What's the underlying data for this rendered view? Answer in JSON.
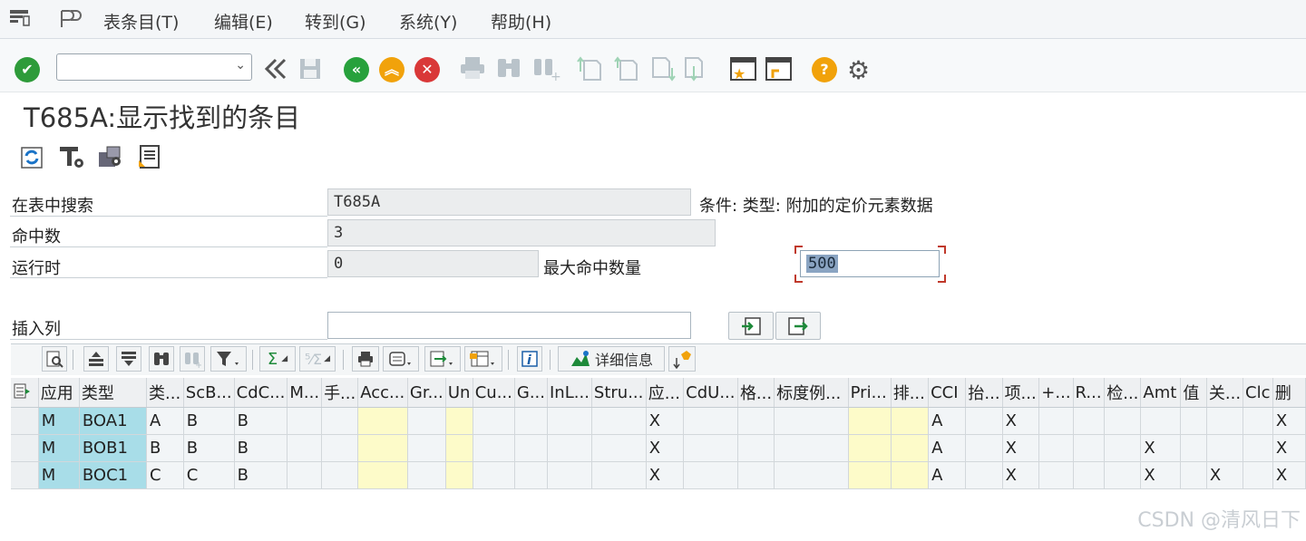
{
  "menubar": {
    "items": [
      "表条目(T)",
      "编辑(E)",
      "转到(G)",
      "系统(Y)",
      "帮助(H)"
    ]
  },
  "toolbar": {
    "icons": [
      "enter-icon",
      "command-field",
      "collapse-icon",
      "save-icon",
      "back-icon",
      "exit-icon",
      "cancel-icon",
      "print-icon",
      "find-icon",
      "find-next-icon",
      "first-page-icon",
      "prev-page-icon",
      "next-page-icon",
      "last-page-icon",
      "create-session-icon",
      "shortcut-icon",
      "help-icon",
      "settings-icon"
    ],
    "command_value": ""
  },
  "page": {
    "title": "T685A:显示找到的条目"
  },
  "form": {
    "search_table_label": "在表中搜索",
    "search_table_value": "T685A",
    "condition_text": "条件: 类型: 附加的定价元素数据",
    "hits_label": "命中数",
    "hits_value": "3",
    "runtime_label": "运行时",
    "runtime_value": "0",
    "max_hits_label": "最大命中数量",
    "max_hits_value": "500",
    "insert_col_label": "插入列",
    "insert_col_value": ""
  },
  "gridtoolbar": {
    "details_label": "详细信息"
  },
  "table": {
    "headers": [
      "应用",
      "类型",
      "类...",
      "ScB...",
      "CdC...",
      "M...",
      "手...",
      "Acc...",
      "Gr...",
      "Un",
      "Cu...",
      "G...",
      "InL...",
      "Stru...",
      "应...",
      "CdU...",
      "格...",
      "标度例...",
      "Pri...",
      "排...",
      "CCI",
      "抬...",
      "项...",
      "+...",
      "R...",
      "检...",
      "Amt",
      "值",
      "关...",
      "Clc",
      "删"
    ],
    "rows": [
      [
        "M",
        "BOA1",
        "A",
        "B",
        "B",
        "",
        "",
        "",
        "",
        "",
        "",
        "",
        "",
        "",
        "X",
        "",
        "",
        "",
        "",
        "",
        "A",
        "",
        "X",
        "",
        "",
        "",
        "",
        "",
        "",
        "",
        "X"
      ],
      [
        "M",
        "BOB1",
        "B",
        "B",
        "B",
        "",
        "",
        "",
        "",
        "",
        "",
        "",
        "",
        "",
        "X",
        "",
        "",
        "",
        "",
        "",
        "A",
        "",
        "X",
        "",
        "",
        "",
        "X",
        "",
        "",
        "",
        "X"
      ],
      [
        "M",
        "BOC1",
        "C",
        "C",
        "B",
        "",
        "",
        "",
        "",
        "",
        "",
        "",
        "",
        "",
        "X",
        "",
        "",
        "",
        "",
        "",
        "A",
        "",
        "X",
        "",
        "",
        "",
        "X",
        "",
        "X",
        "",
        "X"
      ]
    ]
  },
  "watermark": "CSDN @清风日下",
  "colors": {
    "key_column": "#a8dde8",
    "highlight_column": "#fdfbc9",
    "enter_green": "#2e9b3a",
    "back_green": "#27a13c",
    "exit_orange": "#f1a20b",
    "cancel_red": "#d93838",
    "help_orange": "#f1a20b"
  }
}
